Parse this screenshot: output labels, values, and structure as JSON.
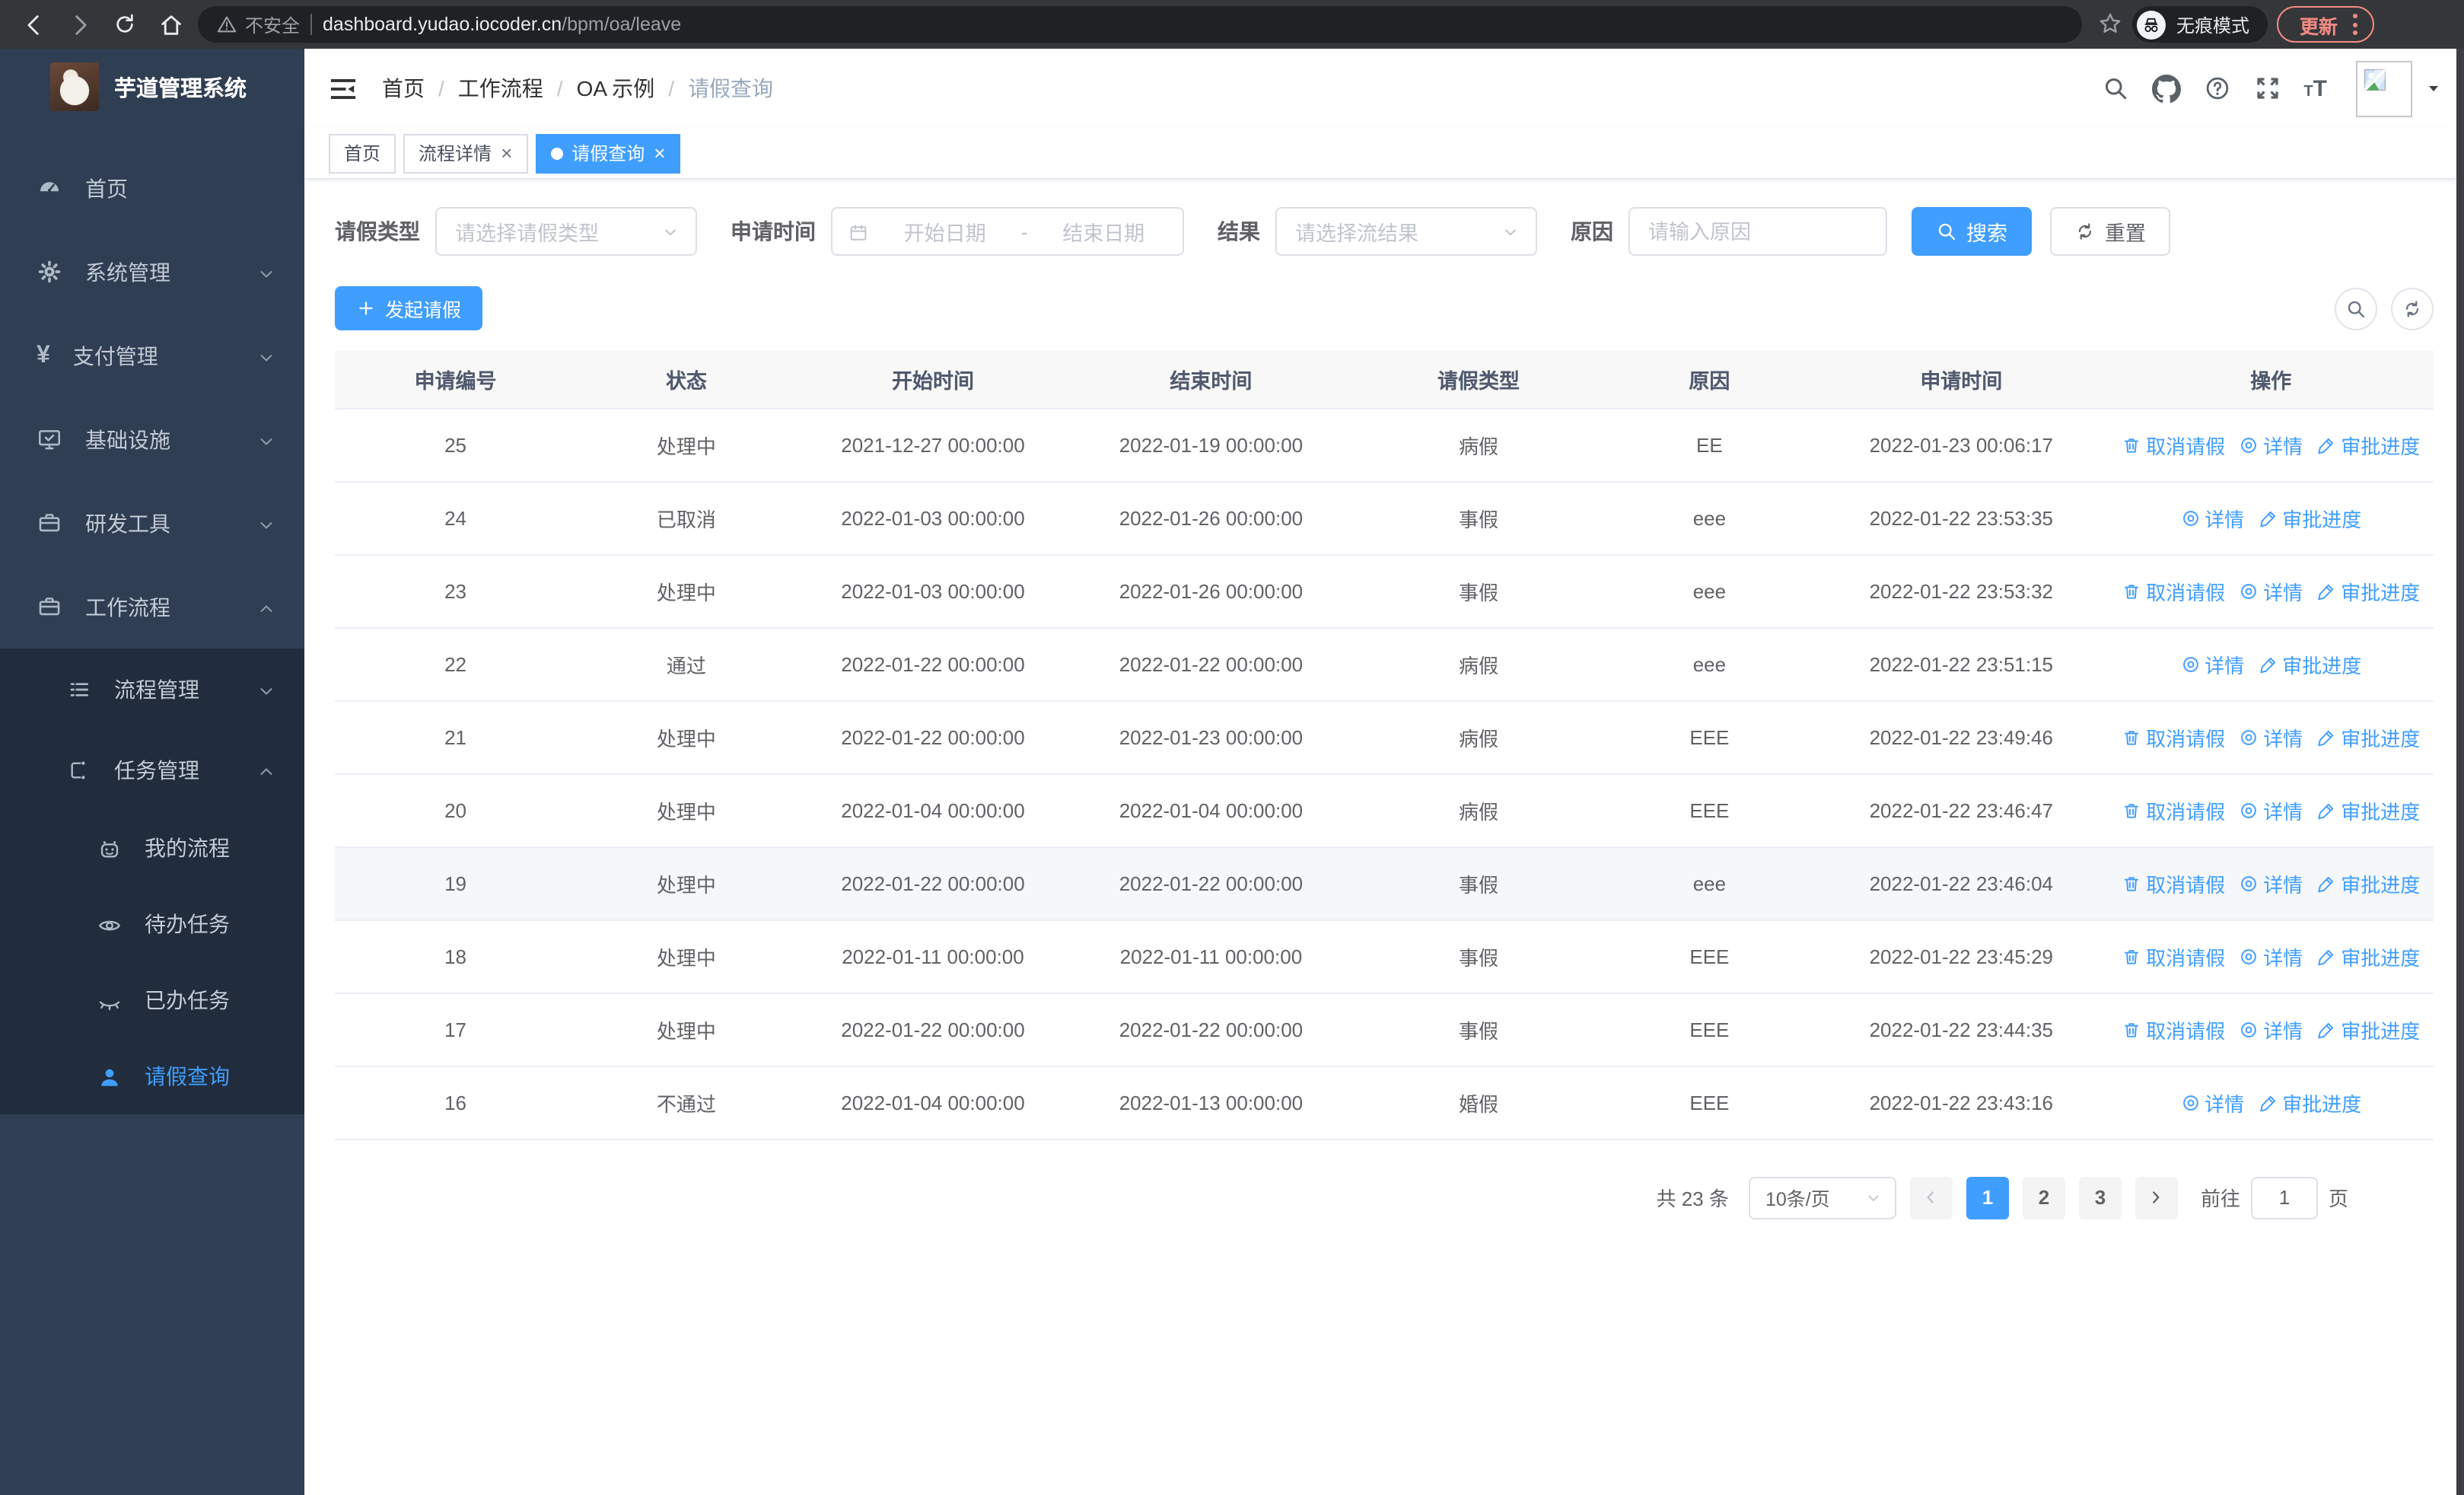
{
  "browser": {
    "security_label": "不安全",
    "url_host": "dashboard.yudao.iocoder.cn",
    "url_path": "/bpm/oa/leave",
    "incognito_label": "无痕模式",
    "update_label": "更新"
  },
  "sidebar": {
    "title": "芋道管理系统",
    "items": [
      {
        "label": "首页"
      },
      {
        "label": "系统管理"
      },
      {
        "label": "支付管理"
      },
      {
        "label": "基础设施"
      },
      {
        "label": "研发工具"
      },
      {
        "label": "工作流程"
      }
    ],
    "submenu": {
      "process_mgmt": "流程管理",
      "task_mgmt": "任务管理",
      "my_process": "我的流程",
      "todo_task": "待办任务",
      "done_task": "已办任务",
      "leave_query": "请假查询"
    }
  },
  "header": {
    "breadcrumb": [
      "首页",
      "工作流程",
      "OA 示例",
      "请假查询"
    ],
    "separator": "/"
  },
  "tabs": [
    {
      "label": "首页"
    },
    {
      "label": "流程详情"
    },
    {
      "label": "请假查询"
    }
  ],
  "filters": {
    "leave_type_label": "请假类型",
    "leave_type_placeholder": "请选择请假类型",
    "apply_time_label": "申请时间",
    "date_start_placeholder": "开始日期",
    "date_separator": "-",
    "date_end_placeholder": "结束日期",
    "result_label": "结果",
    "result_placeholder": "请选择流结果",
    "reason_label": "原因",
    "reason_placeholder": "请输入原因",
    "search_label": "搜索",
    "reset_label": "重置"
  },
  "toolbar": {
    "create_label": "发起请假"
  },
  "table": {
    "headers": [
      "申请编号",
      "状态",
      "开始时间",
      "结束时间",
      "请假类型",
      "原因",
      "申请时间",
      "操作"
    ],
    "action_labels": {
      "cancel": "取消请假",
      "detail": "详情",
      "progress": "审批进度"
    },
    "rows": [
      {
        "id": "25",
        "status": "处理中",
        "start": "2021-12-27 00:00:00",
        "end": "2022-01-19 00:00:00",
        "type": "病假",
        "reason": "EE",
        "applied": "2022-01-23 00:06:17"
      },
      {
        "id": "24",
        "status": "已取消",
        "start": "2022-01-03 00:00:00",
        "end": "2022-01-26 00:00:00",
        "type": "事假",
        "reason": "eee",
        "applied": "2022-01-22 23:53:35"
      },
      {
        "id": "23",
        "status": "处理中",
        "start": "2022-01-03 00:00:00",
        "end": "2022-01-26 00:00:00",
        "type": "事假",
        "reason": "eee",
        "applied": "2022-01-22 23:53:32"
      },
      {
        "id": "22",
        "status": "通过",
        "start": "2022-01-22 00:00:00",
        "end": "2022-01-22 00:00:00",
        "type": "病假",
        "reason": "eee",
        "applied": "2022-01-22 23:51:15"
      },
      {
        "id": "21",
        "status": "处理中",
        "start": "2022-01-22 00:00:00",
        "end": "2022-01-23 00:00:00",
        "type": "病假",
        "reason": "EEE",
        "applied": "2022-01-22 23:49:46"
      },
      {
        "id": "20",
        "status": "处理中",
        "start": "2022-01-04 00:00:00",
        "end": "2022-01-04 00:00:00",
        "type": "病假",
        "reason": "EEE",
        "applied": "2022-01-22 23:46:47"
      },
      {
        "id": "19",
        "status": "处理中",
        "start": "2022-01-22 00:00:00",
        "end": "2022-01-22 00:00:00",
        "type": "事假",
        "reason": "eee",
        "applied": "2022-01-22 23:46:04"
      },
      {
        "id": "18",
        "status": "处理中",
        "start": "2022-01-11 00:00:00",
        "end": "2022-01-11 00:00:00",
        "type": "事假",
        "reason": "EEE",
        "applied": "2022-01-22 23:45:29"
      },
      {
        "id": "17",
        "status": "处理中",
        "start": "2022-01-22 00:00:00",
        "end": "2022-01-22 00:00:00",
        "type": "事假",
        "reason": "EEE",
        "applied": "2022-01-22 23:44:35"
      },
      {
        "id": "16",
        "status": "不通过",
        "start": "2022-01-04 00:00:00",
        "end": "2022-01-13 00:00:00",
        "type": "婚假",
        "reason": "EEE",
        "applied": "2022-01-22 23:43:16"
      }
    ]
  },
  "pagination": {
    "total": "共 23 条",
    "page_size": "10条/页",
    "pages": [
      "1",
      "2",
      "3"
    ],
    "goto_label": "前往",
    "goto_value": "1",
    "goto_suffix": "页"
  },
  "colors": {
    "accent": "#409eff",
    "sidebar_bg": "#2f3e52",
    "submenu_bg": "#212c3c",
    "update_pill": "#f28b82"
  }
}
